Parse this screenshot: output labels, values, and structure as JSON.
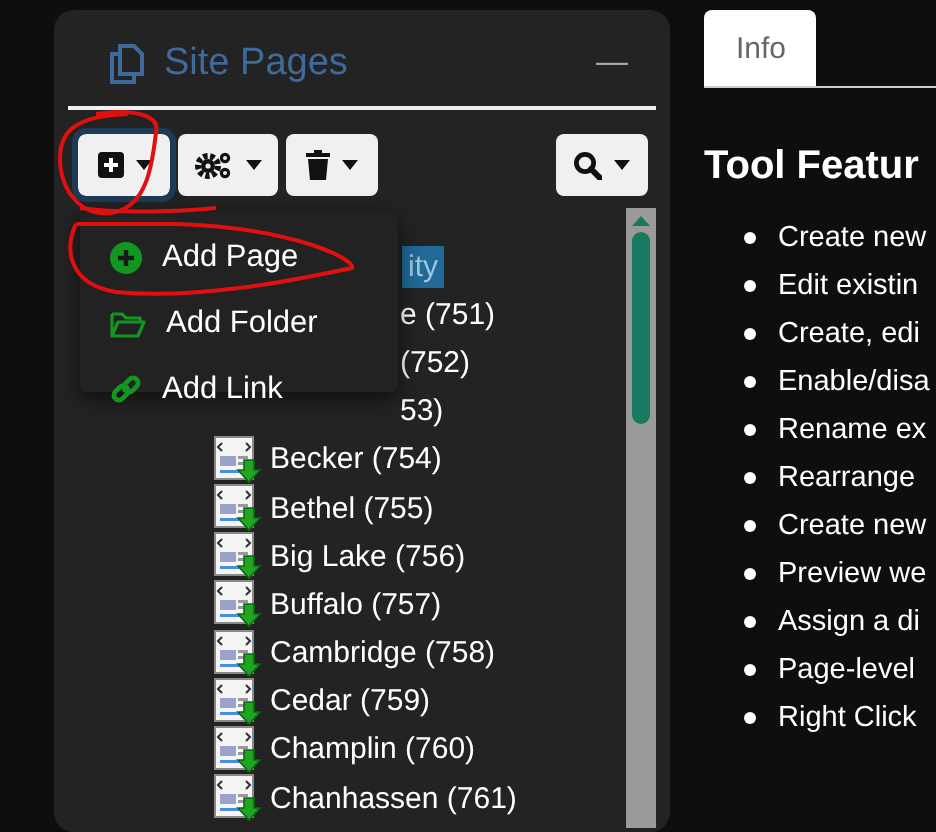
{
  "panel": {
    "title": "Site Pages",
    "minimize": "—"
  },
  "toolbar": [
    {
      "kind": "add",
      "focused": true
    },
    {
      "kind": "gears",
      "focused": false
    },
    {
      "kind": "trash",
      "focused": false
    },
    {
      "kind": "search",
      "focused": false
    }
  ],
  "menu": {
    "items": [
      {
        "label": "Add Page",
        "kind": "page"
      },
      {
        "label": "Add Folder",
        "kind": "folder"
      },
      {
        "label": "Add Link",
        "kind": "link"
      }
    ]
  },
  "tree": {
    "rows": [
      {
        "label": "ity",
        "selected": true,
        "covered": true
      },
      {
        "label": "e (751)",
        "selected": false,
        "covered": true
      },
      {
        "label": "(752)",
        "selected": false,
        "covered": true
      },
      {
        "label": "53)",
        "selected": false,
        "covered": true
      },
      {
        "label": "Becker (754)",
        "selected": false,
        "covered": false
      },
      {
        "label": "Bethel (755)",
        "selected": false,
        "covered": false
      },
      {
        "label": "Big Lake (756)",
        "selected": false,
        "covered": false
      },
      {
        "label": "Buffalo (757)",
        "selected": false,
        "covered": false
      },
      {
        "label": "Cambridge (758)",
        "selected": false,
        "covered": false
      },
      {
        "label": "Cedar (759)",
        "selected": false,
        "covered": false
      },
      {
        "label": "Champlin (760)",
        "selected": false,
        "covered": false
      },
      {
        "label": "Chanhassen (761)",
        "selected": false,
        "covered": false
      }
    ]
  },
  "tabs": [
    {
      "label": "Info",
      "selected": true
    }
  ],
  "heading": "Tool Featur",
  "features": [
    "Create new",
    "Edit existin",
    "Create, edi",
    "Enable/disa",
    "Rename ex",
    "Rearrange",
    "Create new",
    "Preview we",
    "Assign a di",
    "Page-level",
    "Right Click"
  ]
}
